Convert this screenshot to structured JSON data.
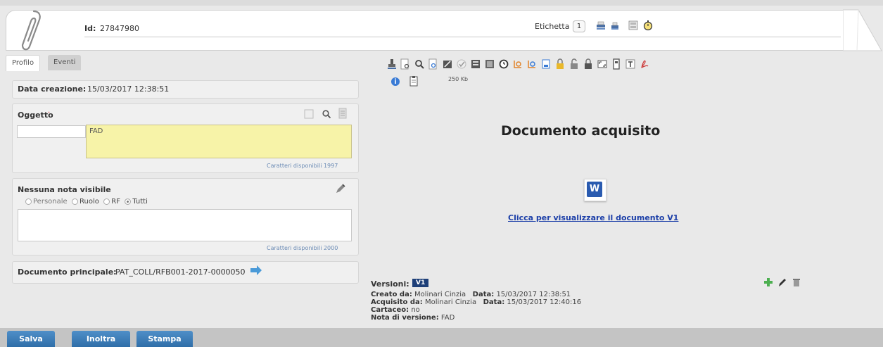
{
  "header": {
    "id_label": "Id:",
    "id_value": "27847980",
    "etichetta_label": "Etichetta",
    "etichetta_count": "1"
  },
  "tabs": [
    {
      "label": "Profilo"
    },
    {
      "label": "Eventi"
    }
  ],
  "profile": {
    "data_creazione_label": "Data creazione:",
    "data_creazione_value": "15/03/2017 12:38:51",
    "oggetto_label": "Oggetto",
    "oggetto_code": "",
    "oggetto_text": "FAD",
    "oggetto_chars": "Caratteri disponibili 1997",
    "note_label": "Nessuna nota visibile",
    "note_options": [
      "Personale",
      "Ruolo",
      "RF",
      "Tutti"
    ],
    "note_selected": "Tutti",
    "note_text": "",
    "note_chars": "Caratteri disponibili 2000",
    "doc_principale_label": "Documento principale:",
    "doc_principale_value": "PAT_COLL/RFB001-2017-0000050"
  },
  "viewer": {
    "file_size": "250 Kb",
    "title": "Documento acquisito",
    "link": "Clicca per visualizzare il documento V1",
    "word_icon_letter": "W"
  },
  "versions": {
    "label": "Versioni:",
    "current": "V1",
    "creato_da_label": "Creato da:",
    "creato_da_value": "Molinari Cinzia",
    "data1_label": "Data:",
    "data1_value": "15/03/2017 12:38:51",
    "acquisito_da_label": "Acquisito da:",
    "acquisito_da_value": "Molinari Cinzia",
    "data2_label": "Data:",
    "data2_value": "15/03/2017 12:40:16",
    "cartaceo_label": "Cartaceo:",
    "cartaceo_value": "no",
    "nota_label": "Nota di versione:",
    "nota_value": "FAD"
  },
  "buttons": {
    "salva": "Salva",
    "inoltra": "Inoltra",
    "stampa": "Stampa"
  },
  "colors": {
    "accent": "#2f6ea8",
    "oggetto_bg": "#f7f3a8",
    "link": "#1c3fa8"
  }
}
